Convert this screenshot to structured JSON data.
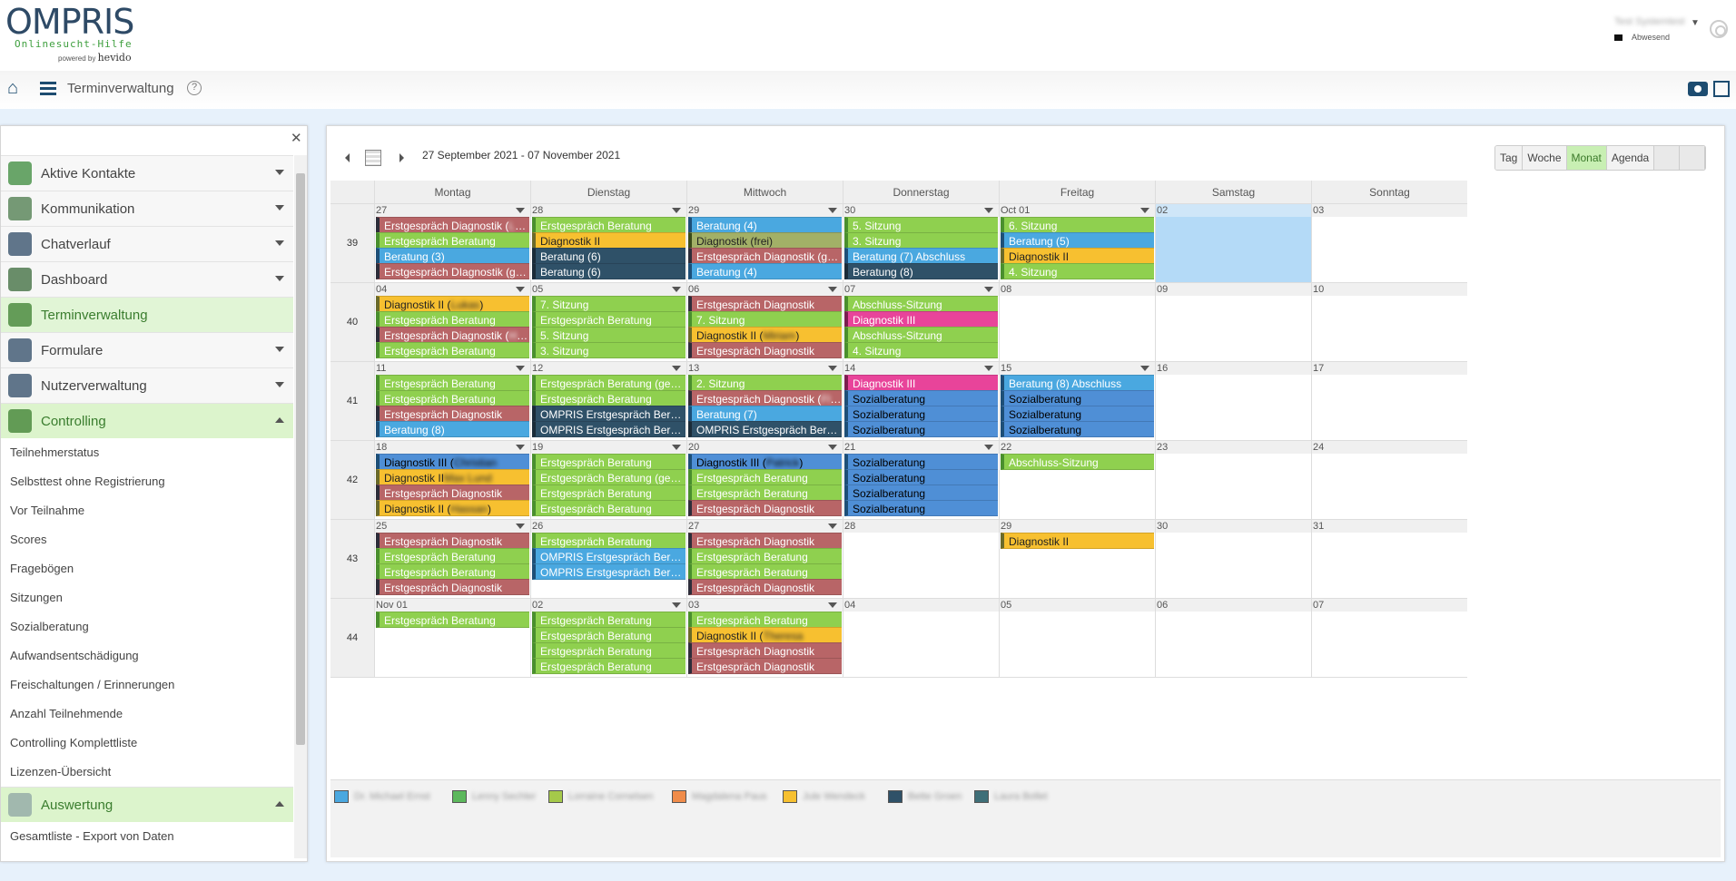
{
  "app": {
    "logo": "OMPRIS",
    "logo_sub": "Onlinesucht-Hilfe",
    "powered": "powered by",
    "powered_brand": "hevido"
  },
  "user": {
    "name": "Test Systemtest",
    "status": "Abwesend"
  },
  "toolbar": {
    "title": "Terminverwaltung",
    "help": "?"
  },
  "sidebar": {
    "items": [
      {
        "label": "Aktive Kontakte",
        "state": "collapsed",
        "icon": "search-person-icon",
        "color": "#3a8a3a"
      },
      {
        "label": "Kommunikation",
        "state": "collapsed",
        "icon": "people-icon",
        "color": "#4a7a4a"
      },
      {
        "label": "Chatverlauf",
        "state": "collapsed",
        "icon": "chat-icon",
        "color": "#2e4a66"
      },
      {
        "label": "Dashboard",
        "state": "collapsed",
        "icon": "dashboard-icon",
        "color": "#3a6a3a"
      },
      {
        "label": "Terminverwaltung",
        "state": "active",
        "icon": "calendar-clock-icon",
        "color": "#3a7d2e"
      },
      {
        "label": "Formulare",
        "state": "collapsed",
        "icon": "form-icon",
        "color": "#2e4a66"
      },
      {
        "label": "Nutzerverwaltung",
        "state": "collapsed",
        "icon": "user-gear-icon",
        "color": "#2e4a66"
      },
      {
        "label": "Controlling",
        "state": "expanded",
        "icon": "chart-search-icon",
        "color": "#3a7d2e"
      }
    ],
    "controlling_sub": [
      "Teilnehmerstatus",
      "Selbsttest ohne Registrierung",
      "Vor Teilnahme",
      "Scores",
      "Fragebögen",
      "Sitzungen",
      "Sozialberatung",
      "Aufwandsentschädigung",
      "Freischaltungen / Erinnerungen",
      "Anzahl Teilnehmende",
      "Controlling Komplettliste",
      "Lizenzen-Übersicht"
    ],
    "auswertung": {
      "label": "Auswertung",
      "icon": "calendar-grid-icon"
    },
    "auswertung_sub": [
      "Gesamtliste - Export von Daten"
    ]
  },
  "calendar": {
    "range": "27 September 2021 - 07 November 2021",
    "views": [
      "Tag",
      "Woche",
      "Monat",
      "Agenda"
    ],
    "selected_view": "Monat",
    "days": [
      "Montag",
      "Dienstag",
      "Mittwoch",
      "Donnerstag",
      "Freitag",
      "Samstag",
      "Sonntag"
    ],
    "weeks": [
      {
        "num": "39",
        "dates": [
          "27",
          "28",
          "29",
          "30",
          "Oct 01",
          "02",
          "03"
        ],
        "today": 5,
        "events": [
          [
            {
              "t": "Erstgespräch Diagnostik (",
              "c": "r",
              "blur": "Leonie"
            },
            {
              "t": "Erstgespräch Beratung",
              "c": "g"
            },
            {
              "t": "Beratung (3)",
              "c": "b"
            },
            {
              "t": "Erstgespräch DIagnostik (gebucht)",
              "c": "r"
            }
          ],
          [
            {
              "t": "Erstgespräch Beratung",
              "c": "g"
            },
            {
              "t": "Diagnostik II",
              "c": "y"
            },
            {
              "t": "Beratung (6)",
              "c": "d"
            },
            {
              "t": "Beratung (6)",
              "c": "d"
            }
          ],
          [
            {
              "t": "Beratung (4)",
              "c": "b"
            },
            {
              "t": "Diagnostik (frei)",
              "c": "o"
            },
            {
              "t": "Erstgespräch Diagnostik (gebucht)",
              "c": "r"
            },
            {
              "t": "Beratung (4)",
              "c": "b"
            }
          ],
          [
            {
              "t": "5. Sitzung",
              "c": "g"
            },
            {
              "t": "3. Sitzung",
              "c": "g"
            },
            {
              "t": "Beratung (7) Abschluss",
              "c": "b"
            },
            {
              "t": "Beratung (8)",
              "c": "d"
            }
          ],
          [
            {
              "t": "6. Sitzung",
              "c": "g"
            },
            {
              "t": "Beratung (5)",
              "c": "b"
            },
            {
              "t": "Diagnostik II",
              "c": "y"
            },
            {
              "t": "4. Sitzung",
              "c": "g"
            }
          ],
          [],
          []
        ]
      },
      {
        "num": "40",
        "dates": [
          "04",
          "05",
          "06",
          "07",
          "08",
          "09",
          "10"
        ],
        "events": [
          [
            {
              "t": "Diagnostik II (",
              "c": "y",
              "blur": "Lukas",
              "tail": ")"
            },
            {
              "t": "Erstgespräch Beratung",
              "c": "g"
            },
            {
              "t": "Erstgespräch Diagnostik (",
              "c": "r",
              "blur": "Hannah",
              "tail": ")"
            },
            {
              "t": "Erstgespräch Beratung",
              "c": "g"
            }
          ],
          [
            {
              "t": "7. Sitzung",
              "c": "g"
            },
            {
              "t": "Erstgespräch Beratung",
              "c": "g"
            },
            {
              "t": "5. Sitzung",
              "c": "g"
            },
            {
              "t": "3. Sitzung",
              "c": "g"
            }
          ],
          [
            {
              "t": "Erstgespräch Diagnostik",
              "c": "r"
            },
            {
              "t": "7. Sitzung",
              "c": "g"
            },
            {
              "t": "Diagnostik II (",
              "c": "y",
              "blur": "Miriam",
              "tail": ")"
            },
            {
              "t": "Erstgespräch Diagnostik",
              "c": "r"
            }
          ],
          [
            {
              "t": "Abschluss-Sitzung",
              "c": "g"
            },
            {
              "t": "Diagnostik III",
              "c": "p"
            },
            {
              "t": "Abschluss-Sitzung",
              "c": "g"
            },
            {
              "t": "4. Sitzung",
              "c": "g"
            }
          ],
          [],
          [],
          []
        ]
      },
      {
        "num": "41",
        "dates": [
          "11",
          "12",
          "13",
          "14",
          "15",
          "16",
          "17"
        ],
        "events": [
          [
            {
              "t": "Erstgespräch Beratung",
              "c": "g"
            },
            {
              "t": "Erstgespräch Beratung",
              "c": "g"
            },
            {
              "t": "Erstgespräch Diagnostik",
              "c": "r"
            },
            {
              "t": "Beratung (8)",
              "c": "b"
            }
          ],
          [
            {
              "t": "Erstgespräch Beratung (gebucht)",
              "c": "g"
            },
            {
              "t": "Erstgespräch Beratung",
              "c": "g"
            },
            {
              "t": "OMPRIS Erstgespräch Berater",
              "c": "d"
            },
            {
              "t": "OMPRIS Erstgespräch Berater",
              "c": "d"
            }
          ],
          [
            {
              "t": "2. Sitzung",
              "c": "g"
            },
            {
              "t": "Erstgespräch Diagnostik (",
              "c": "r",
              "blur": "Florian"
            },
            {
              "t": "Beratung (7)",
              "c": "b"
            },
            {
              "t": "OMPRIS Erstgespräch Berater",
              "c": "d"
            }
          ],
          [
            {
              "t": "Diagnostik III",
              "c": "p"
            },
            {
              "t": "Sozialberatung",
              "c": "m"
            },
            {
              "t": "Sozialberatung",
              "c": "m"
            },
            {
              "t": "Sozialberatung",
              "c": "m"
            }
          ],
          [
            {
              "t": "Beratung (8) Abschluss",
              "c": "b"
            },
            {
              "t": "Sozialberatung",
              "c": "m"
            },
            {
              "t": "Sozialberatung",
              "c": "m"
            },
            {
              "t": "Sozialberatung",
              "c": "m"
            }
          ],
          [],
          []
        ]
      },
      {
        "num": "42",
        "dates": [
          "18",
          "19",
          "20",
          "21",
          "22",
          "23",
          "24"
        ],
        "events": [
          [
            {
              "t": "Diagnostik III (",
              "c": "m",
              "blur": "Christian"
            },
            {
              "t": "Diagnostik II",
              "c": "y",
              "blur": "Max Lund"
            },
            {
              "t": "Erstgespräch Diagnostik",
              "c": "r"
            },
            {
              "t": "Diagnostik II (",
              "c": "y",
              "blur": "Hassan",
              "tail": ")"
            }
          ],
          [
            {
              "t": "Erstgespräch Beratung",
              "c": "g"
            },
            {
              "t": "Erstgespräch Beratung (gebucht)",
              "c": "g"
            },
            {
              "t": "Erstgespräch Beratung",
              "c": "g"
            },
            {
              "t": "Erstgespräch Beratung",
              "c": "g"
            }
          ],
          [
            {
              "t": "Diagnostik III (",
              "c": "m",
              "blur": "Patrick",
              "tail": ")"
            },
            {
              "t": "Erstgespräch Beratung",
              "c": "g"
            },
            {
              "t": "Erstgespräch Beratung",
              "c": "g"
            },
            {
              "t": "Erstgespräch Diagnostik",
              "c": "r"
            }
          ],
          [
            {
              "t": "Sozialberatung",
              "c": "m"
            },
            {
              "t": "Sozialberatung",
              "c": "m"
            },
            {
              "t": "Sozialberatung",
              "c": "m"
            },
            {
              "t": "Sozialberatung",
              "c": "m"
            }
          ],
          [
            {
              "t": "Abschluss-Sitzung",
              "c": "g"
            }
          ],
          [],
          []
        ]
      },
      {
        "num": "43",
        "dates": [
          "25",
          "26",
          "27",
          "28",
          "29",
          "30",
          "31"
        ],
        "events": [
          [
            {
              "t": "Erstgespräch Diagnostik",
              "c": "r"
            },
            {
              "t": "Erstgespräch Beratung",
              "c": "g"
            },
            {
              "t": "Erstgespräch Beratung",
              "c": "g"
            },
            {
              "t": "Erstgespräch Diagnostik",
              "c": "r"
            }
          ],
          [
            {
              "t": "Erstgespräch Beratung",
              "c": "g"
            },
            {
              "t": "OMPRIS Erstgespräch Berater",
              "c": "b"
            },
            {
              "t": "OMPRIS Erstgespräch Berater (g…",
              "c": "b"
            }
          ],
          [
            {
              "t": "Erstgespräch Diagnostik",
              "c": "r"
            },
            {
              "t": "Erstgespräch Beratung",
              "c": "g"
            },
            {
              "t": "Erstgespräch Beratung",
              "c": "g"
            },
            {
              "t": "Erstgespräch Diagnostik",
              "c": "r"
            }
          ],
          [],
          [
            {
              "t": "Diagnostik II",
              "c": "y"
            }
          ],
          [],
          []
        ]
      },
      {
        "num": "44",
        "dates": [
          "Nov 01",
          "02",
          "03",
          "04",
          "05",
          "06",
          "07"
        ],
        "events": [
          [
            {
              "t": "Erstgespräch Beratung",
              "c": "g"
            }
          ],
          [
            {
              "t": "Erstgespräch Beratung",
              "c": "g"
            },
            {
              "t": "Erstgespräch Beratung",
              "c": "g"
            },
            {
              "t": "Erstgespräch Beratung",
              "c": "g"
            },
            {
              "t": "Erstgespräch Beratung",
              "c": "g"
            }
          ],
          [
            {
              "t": "Erstgespräch Beratung",
              "c": "g"
            },
            {
              "t": "Diagnostik II (",
              "c": "y",
              "blur": "Theresa"
            },
            {
              "t": "Erstgespräch Diagnostik",
              "c": "r"
            },
            {
              "t": "Erstgespräch Diagnostik",
              "c": "r"
            }
          ],
          [],
          [],
          [],
          []
        ]
      }
    ],
    "legend": [
      {
        "name": "Dr. Michael Ernst",
        "color": "#4aa8e0"
      },
      {
        "name": "Lenny Sechler",
        "color": "#5cb85c"
      },
      {
        "name": "Lorraine Cornelsen",
        "color": "#a5c94a"
      },
      {
        "name": "Magdalena Paus",
        "color": "#f08c4a"
      },
      {
        "name": "Jule Wendeck",
        "color": "#f7c030"
      },
      {
        "name": "Bette Groen",
        "color": "#2f5168"
      },
      {
        "name": "Laura Bollet",
        "color": "#3f6f78"
      }
    ]
  }
}
